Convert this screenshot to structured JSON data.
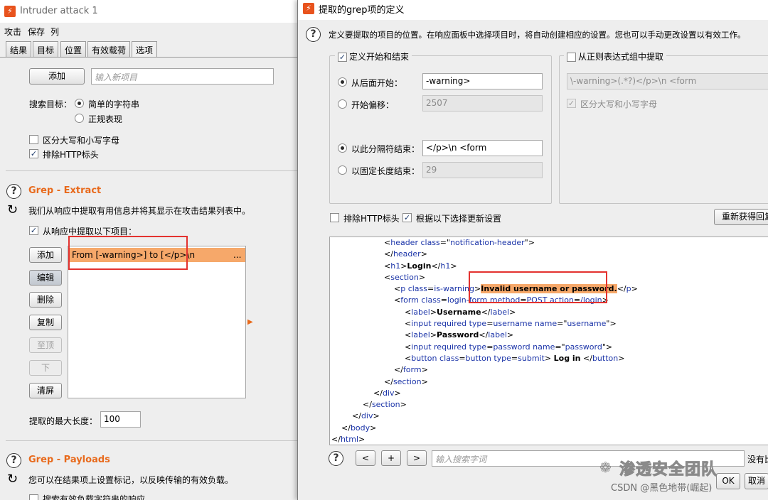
{
  "left_window": {
    "title": "Intruder attack 1",
    "menu": [
      "攻击",
      "保存",
      "列"
    ],
    "tabs": [
      "结果",
      "目标",
      "位置",
      "有效载荷",
      "选项"
    ],
    "add_button": "添加",
    "new_item_placeholder": "输入新项目",
    "search_target_label": "搜索目标：",
    "radio_simple": "简单的字符串",
    "radio_regex": "正规表现",
    "case_sensitive": "区分大写和小写字母",
    "exclude_http": "排除HTTP标头",
    "grep_extract": {
      "title": "Grep - Extract",
      "desc": "我们从响应中提取有用信息并将其显示在攻击结果列表中。",
      "checkbox": "从响应中提取以下项目：",
      "buttons": [
        "添加",
        "编辑",
        "删除",
        "复制",
        "至顶",
        "下",
        "清屏"
      ],
      "list_item": "From [-warning>] to [</p>\\n",
      "list_item_ellipsis": "...",
      "max_len_label": "提取的最大长度：",
      "max_len_value": "100"
    },
    "grep_payloads": {
      "title": "Grep - Payloads",
      "desc": "您可以在结果项上设置标记，以反映传输的有效负载。",
      "checkbox": "搜索有效负载字符串的响应"
    }
  },
  "dialog": {
    "title": "提取的grep项的定义",
    "desc": "定义要提取的项目的位置。在响应面板中选择项目时，将自动创建相应的设置。您也可以手动更改设置以有效工作。",
    "define_group": "定义开始和结束",
    "start_after_label": "从后面开始：",
    "start_after_value": "-warning>",
    "start_offset_label": "开始偏移：",
    "start_offset_value": "2507",
    "end_delim_label": "以此分隔符结束：",
    "end_delim_value": "</p>\\n                <form",
    "fixed_len_label": "以固定长度结束：",
    "fixed_len_value": "29",
    "regex_group": "从正则表达式组中提取",
    "regex_value": "\\-warning>(.*?)</p>\\n                <form",
    "regex_case": "区分大写和小写字母",
    "exclude_http": "排除HTTP标头",
    "update_config": "根据以下选择更新设置",
    "refetch_button": "重新获得回复",
    "search_placeholder": "输入搜索字词",
    "no_match": "没有比",
    "ok_button": "OK",
    "cancel_button": "取消",
    "nav_prev": "<",
    "nav_add": "+",
    "nav_next": ">",
    "help": "?"
  },
  "watermark": {
    "brand": "渗透安全团队",
    "csdn": "CSDN @黑色地带(崛起)"
  },
  "colors": {
    "accent_orange": "#e86a1c",
    "highlight": "#f6a86a",
    "annotation_red": "#e3322f",
    "code_tag": "#1b34a8"
  }
}
